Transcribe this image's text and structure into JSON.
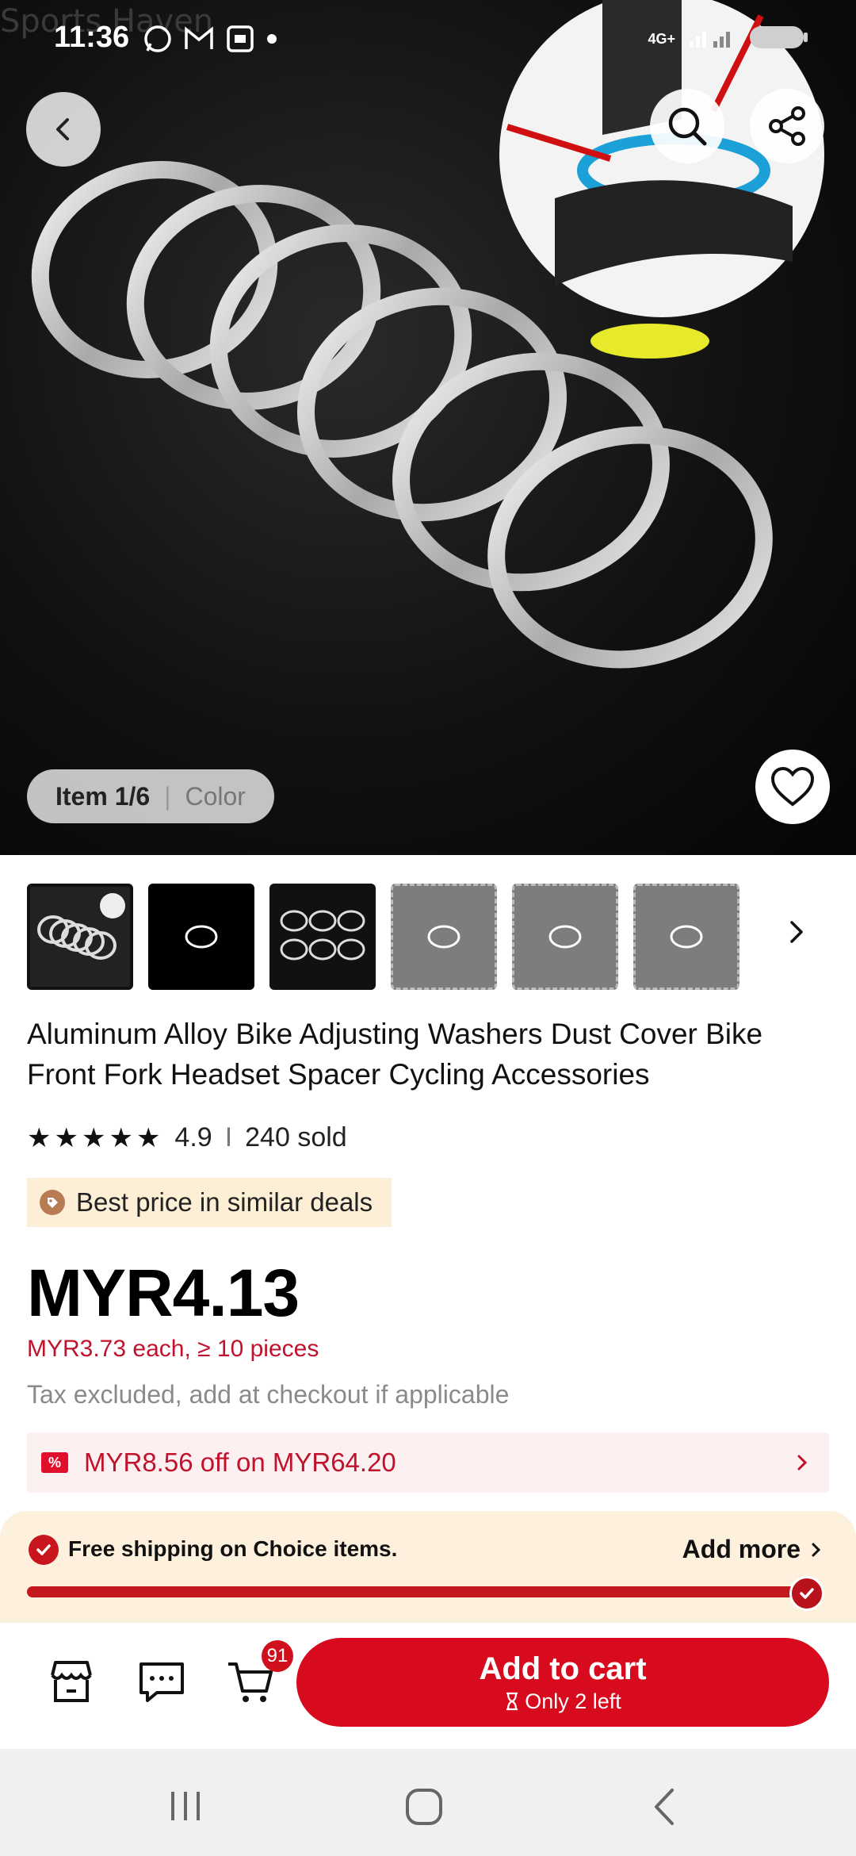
{
  "status_bar": {
    "time": "11:36",
    "network": "4G+",
    "icons": [
      "whatsapp-icon",
      "gmail-icon",
      "screenshot-icon",
      "dot-icon"
    ]
  },
  "watermark": "Sports Haven",
  "gallery": {
    "item_counter": "Item 1/6",
    "separator": "|",
    "variant_label": "Color",
    "thumbnail_count": 6,
    "active_index": 0
  },
  "product": {
    "title": "Aluminum Alloy Bike Adjusting Washers Dust Cover Bike Front Fork Headset Spacer Cycling Accessories",
    "rating": "4.9",
    "rating_separator": "I",
    "sold": "240 sold",
    "stars": 5,
    "badge": "Best price in similar deals",
    "price": "MYR4.13",
    "bulk_price": "MYR3.73 each, ≥ 10 pieces",
    "tax_note": "Tax excluded, add at checkout if applicable",
    "coupon_icon": "%",
    "coupon": "MYR8.56 off on MYR64.20"
  },
  "shipping": {
    "text": "Free shipping on  Choice  items.",
    "add_more": "Add more",
    "progress": 1.0
  },
  "action_bar": {
    "cart_count": "91",
    "add_to_cart": "Add to cart",
    "stock_note": "Only 2 left"
  },
  "colors": {
    "brand_red": "#d70b1d",
    "price_red": "#c0122c",
    "badge_bg": "#fdefd6",
    "shipping_bg": "#fdf0dc"
  }
}
